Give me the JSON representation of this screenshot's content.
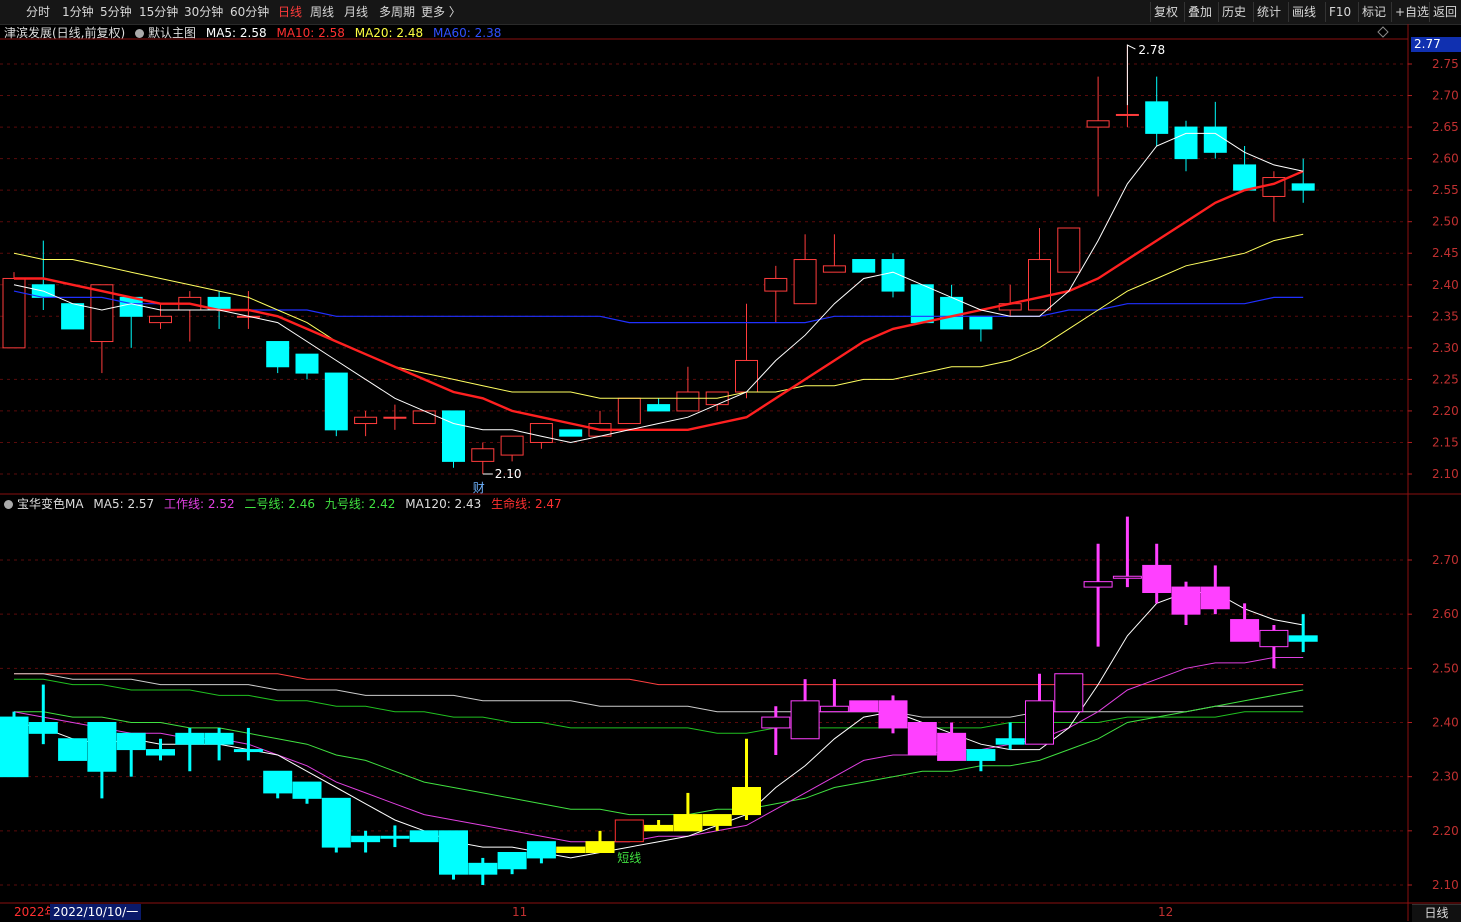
{
  "toolbar": {
    "periods": [
      "分时",
      "1分钟",
      "5分钟",
      "15分钟",
      "30分钟",
      "60分钟",
      "日线",
      "周线",
      "月线",
      "多周期",
      "更多 〉"
    ],
    "active_period": "日线",
    "right_buttons": [
      "复权",
      "叠加",
      "历史",
      "统计",
      "画线",
      "F10",
      "标记",
      "+自选",
      "返回"
    ]
  },
  "main_legend": {
    "stock": "津滨发展(日线,前复权)",
    "template": "默认主图",
    "ma5": "MA5: 2.58",
    "ma10": "MA10: 2.58",
    "ma20": "MA20: 2.48",
    "ma60": "MA60: 2.38"
  },
  "sub_legend": {
    "indicator": "宝华变色MA",
    "ma5": "MA5: 2.57",
    "work": "工作线: 2.52",
    "line2": "二号线: 2.46",
    "line9": "九号线: 2.42",
    "ma120": "MA120: 2.43",
    "life": "生命线: 2.47"
  },
  "annotations": {
    "high_label": "2.78",
    "low_label": "2.10",
    "cai_label": "财",
    "short_label": "短线",
    "current_price": "2.77"
  },
  "axis": {
    "main_ticks": [
      "2.75",
      "2.70",
      "2.65",
      "2.60",
      "2.55",
      "2.50",
      "2.45",
      "2.40",
      "2.35",
      "2.30",
      "2.25",
      "2.20",
      "2.15",
      "2.10"
    ],
    "sub_ticks": [
      "2.70",
      "2.60",
      "2.50",
      "2.40",
      "2.30",
      "2.20",
      "2.10"
    ],
    "year_label": "2022年",
    "date_label": "2022/10/10/一",
    "month_ticks": [
      "11",
      "12"
    ],
    "period_label": "日线"
  },
  "colors": {
    "up": "#ff3c3c",
    "down": "#00ffff",
    "ma5": "#ffffff",
    "ma10": "#ff2020",
    "ma20": "#ffff60",
    "ma60": "#2030ff",
    "work": "#e040e0",
    "line2": "#40e040",
    "life": "#ff4040",
    "grid": "#801010"
  },
  "chart_data": {
    "type": "candlestick",
    "candles": [
      {
        "o": 2.3,
        "c": 2.41,
        "h": 2.42,
        "l": 2.3
      },
      {
        "o": 2.4,
        "c": 2.38,
        "h": 2.47,
        "l": 2.36
      },
      {
        "o": 2.37,
        "c": 2.33,
        "h": 2.37,
        "l": 2.33
      },
      {
        "o": 2.31,
        "c": 2.4,
        "h": 2.4,
        "l": 2.26
      },
      {
        "o": 2.38,
        "c": 2.35,
        "h": 2.38,
        "l": 2.3
      },
      {
        "o": 2.34,
        "c": 2.35,
        "h": 2.37,
        "l": 2.33
      },
      {
        "o": 2.36,
        "c": 2.38,
        "h": 2.39,
        "l": 2.31
      },
      {
        "o": 2.38,
        "c": 2.36,
        "h": 2.39,
        "l": 2.33
      },
      {
        "o": 2.35,
        "c": 2.35,
        "h": 2.39,
        "l": 2.33
      },
      {
        "o": 2.31,
        "c": 2.27,
        "h": 2.31,
        "l": 2.26
      },
      {
        "o": 2.29,
        "c": 2.26,
        "h": 2.29,
        "l": 2.25
      },
      {
        "o": 2.26,
        "c": 2.17,
        "h": 2.26,
        "l": 2.16
      },
      {
        "o": 2.18,
        "c": 2.19,
        "h": 2.2,
        "l": 2.16
      },
      {
        "o": 2.19,
        "c": 2.19,
        "h": 2.21,
        "l": 2.17
      },
      {
        "o": 2.18,
        "c": 2.2,
        "h": 2.2,
        "l": 2.18
      },
      {
        "o": 2.2,
        "c": 2.12,
        "h": 2.2,
        "l": 2.11
      },
      {
        "o": 2.12,
        "c": 2.14,
        "h": 2.15,
        "l": 2.1
      },
      {
        "o": 2.13,
        "c": 2.16,
        "h": 2.16,
        "l": 2.12
      },
      {
        "o": 2.15,
        "c": 2.18,
        "h": 2.18,
        "l": 2.14
      },
      {
        "o": 2.17,
        "c": 2.16,
        "h": 2.17,
        "l": 2.16
      },
      {
        "o": 2.16,
        "c": 2.18,
        "h": 2.2,
        "l": 2.16
      },
      {
        "o": 2.18,
        "c": 2.22,
        "h": 2.22,
        "l": 2.18
      },
      {
        "o": 2.21,
        "c": 2.2,
        "h": 2.22,
        "l": 2.2
      },
      {
        "o": 2.2,
        "c": 2.23,
        "h": 2.27,
        "l": 2.2
      },
      {
        "o": 2.21,
        "c": 2.23,
        "h": 2.23,
        "l": 2.2
      },
      {
        "o": 2.23,
        "c": 2.28,
        "h": 2.37,
        "l": 2.22
      },
      {
        "o": 2.39,
        "c": 2.41,
        "h": 2.43,
        "l": 2.34
      },
      {
        "o": 2.37,
        "c": 2.44,
        "h": 2.48,
        "l": 2.37
      },
      {
        "o": 2.42,
        "c": 2.43,
        "h": 2.48,
        "l": 2.42
      },
      {
        "o": 2.44,
        "c": 2.42,
        "h": 2.44,
        "l": 2.42
      },
      {
        "o": 2.44,
        "c": 2.39,
        "h": 2.45,
        "l": 2.38
      },
      {
        "o": 2.4,
        "c": 2.34,
        "h": 2.4,
        "l": 2.34
      },
      {
        "o": 2.38,
        "c": 2.33,
        "h": 2.4,
        "l": 2.33
      },
      {
        "o": 2.35,
        "c": 2.33,
        "h": 2.35,
        "l": 2.31
      },
      {
        "o": 2.36,
        "c": 2.37,
        "h": 2.4,
        "l": 2.35
      },
      {
        "o": 2.36,
        "c": 2.44,
        "h": 2.49,
        "l": 2.36
      },
      {
        "o": 2.42,
        "c": 2.49,
        "h": 2.49,
        "l": 2.42
      },
      {
        "o": 2.65,
        "c": 2.66,
        "h": 2.73,
        "l": 2.54
      },
      {
        "o": 2.67,
        "c": 2.67,
        "h": 2.78,
        "l": 2.65
      },
      {
        "o": 2.69,
        "c": 2.64,
        "h": 2.73,
        "l": 2.62
      },
      {
        "o": 2.65,
        "c": 2.6,
        "h": 2.66,
        "l": 2.58
      },
      {
        "o": 2.65,
        "c": 2.61,
        "h": 2.69,
        "l": 2.6
      },
      {
        "o": 2.59,
        "c": 2.55,
        "h": 2.62,
        "l": 2.55
      },
      {
        "o": 2.54,
        "c": 2.57,
        "h": 2.58,
        "l": 2.5
      },
      {
        "o": 2.56,
        "c": 2.55,
        "h": 2.6,
        "l": 2.53
      }
    ],
    "ma5": [
      2.4,
      2.39,
      2.37,
      2.36,
      2.37,
      2.36,
      2.36,
      2.36,
      2.35,
      2.34,
      2.31,
      2.28,
      2.25,
      2.22,
      2.2,
      2.18,
      2.17,
      2.17,
      2.16,
      2.15,
      2.16,
      2.17,
      2.18,
      2.19,
      2.21,
      2.23,
      2.28,
      2.32,
      2.37,
      2.41,
      2.42,
      2.4,
      2.38,
      2.36,
      2.35,
      2.35,
      2.39,
      2.47,
      2.56,
      2.62,
      2.64,
      2.64,
      2.61,
      2.59,
      2.58
    ],
    "ma10": [
      2.41,
      2.41,
      2.4,
      2.39,
      2.38,
      2.37,
      2.37,
      2.36,
      2.36,
      2.35,
      2.33,
      2.31,
      2.29,
      2.27,
      2.25,
      2.23,
      2.22,
      2.2,
      2.19,
      2.18,
      2.17,
      2.17,
      2.17,
      2.17,
      2.18,
      2.19,
      2.22,
      2.25,
      2.28,
      2.31,
      2.33,
      2.34,
      2.35,
      2.36,
      2.37,
      2.38,
      2.39,
      2.41,
      2.44,
      2.47,
      2.5,
      2.53,
      2.55,
      2.56,
      2.58
    ],
    "ma20": [
      2.45,
      2.44,
      2.44,
      2.43,
      2.42,
      2.41,
      2.4,
      2.39,
      2.38,
      2.36,
      2.34,
      2.31,
      2.29,
      2.27,
      2.26,
      2.25,
      2.24,
      2.23,
      2.23,
      2.23,
      2.22,
      2.22,
      2.22,
      2.22,
      2.22,
      2.23,
      2.23,
      2.24,
      2.24,
      2.25,
      2.25,
      2.26,
      2.27,
      2.27,
      2.28,
      2.3,
      2.33,
      2.36,
      2.39,
      2.41,
      2.43,
      2.44,
      2.45,
      2.47,
      2.48
    ],
    "ma60": [
      2.39,
      2.38,
      2.38,
      2.38,
      2.37,
      2.37,
      2.37,
      2.36,
      2.36,
      2.36,
      2.36,
      2.35,
      2.35,
      2.35,
      2.35,
      2.35,
      2.35,
      2.35,
      2.35,
      2.35,
      2.35,
      2.34,
      2.34,
      2.34,
      2.34,
      2.34,
      2.34,
      2.34,
      2.35,
      2.35,
      2.35,
      2.35,
      2.35,
      2.35,
      2.35,
      2.35,
      2.36,
      2.36,
      2.37,
      2.37,
      2.37,
      2.37,
      2.37,
      2.38,
      2.38
    ],
    "sub_work": [
      2.42,
      2.41,
      2.4,
      2.39,
      2.38,
      2.38,
      2.37,
      2.37,
      2.36,
      2.34,
      2.32,
      2.29,
      2.27,
      2.25,
      2.23,
      2.22,
      2.21,
      2.2,
      2.19,
      2.18,
      2.18,
      2.18,
      2.19,
      2.19,
      2.2,
      2.21,
      2.24,
      2.27,
      2.3,
      2.33,
      2.34,
      2.34,
      2.35,
      2.35,
      2.36,
      2.37,
      2.39,
      2.42,
      2.46,
      2.48,
      2.5,
      2.51,
      2.51,
      2.52,
      2.52
    ],
    "sub_line2": [
      2.42,
      2.42,
      2.41,
      2.41,
      2.4,
      2.4,
      2.39,
      2.39,
      2.38,
      2.37,
      2.36,
      2.34,
      2.33,
      2.31,
      2.29,
      2.28,
      2.27,
      2.26,
      2.25,
      2.24,
      2.24,
      2.23,
      2.23,
      2.23,
      2.24,
      2.24,
      2.25,
      2.26,
      2.28,
      2.29,
      2.3,
      2.31,
      2.31,
      2.32,
      2.32,
      2.33,
      2.35,
      2.37,
      2.4,
      2.41,
      2.42,
      2.43,
      2.44,
      2.45,
      2.46
    ],
    "sub_line9": [
      2.48,
      2.48,
      2.47,
      2.47,
      2.46,
      2.46,
      2.46,
      2.45,
      2.45,
      2.44,
      2.44,
      2.43,
      2.43,
      2.42,
      2.42,
      2.41,
      2.41,
      2.4,
      2.4,
      2.39,
      2.39,
      2.39,
      2.39,
      2.39,
      2.38,
      2.38,
      2.39,
      2.39,
      2.39,
      2.39,
      2.39,
      2.39,
      2.39,
      2.39,
      2.4,
      2.4,
      2.4,
      2.4,
      2.41,
      2.41,
      2.41,
      2.41,
      2.42,
      2.42,
      2.42
    ],
    "sub_ma120": [
      2.49,
      2.49,
      2.48,
      2.48,
      2.48,
      2.47,
      2.47,
      2.47,
      2.47,
      2.46,
      2.46,
      2.46,
      2.45,
      2.45,
      2.45,
      2.45,
      2.44,
      2.44,
      2.44,
      2.44,
      2.43,
      2.43,
      2.43,
      2.43,
      2.42,
      2.42,
      2.42,
      2.42,
      2.42,
      2.42,
      2.42,
      2.41,
      2.41,
      2.41,
      2.41,
      2.42,
      2.42,
      2.42,
      2.42,
      2.42,
      2.42,
      2.43,
      2.43,
      2.43,
      2.43
    ],
    "sub_life": [
      2.49,
      2.49,
      2.49,
      2.49,
      2.49,
      2.49,
      2.49,
      2.49,
      2.49,
      2.49,
      2.48,
      2.48,
      2.48,
      2.48,
      2.48,
      2.48,
      2.48,
      2.48,
      2.48,
      2.48,
      2.48,
      2.48,
      2.47,
      2.47,
      2.47,
      2.47,
      2.47,
      2.47,
      2.47,
      2.47,
      2.47,
      2.47,
      2.47,
      2.47,
      2.47,
      2.47,
      2.47,
      2.47,
      2.47,
      2.47,
      2.47,
      2.47,
      2.47,
      2.47,
      2.47
    ],
    "sub_colors": [
      "cyan",
      "cyan",
      "cyan",
      "cyan",
      "cyan",
      "cyan",
      "cyan",
      "cyan",
      "cyan",
      "cyan",
      "cyan",
      "cyan",
      "cyan",
      "cyan",
      "cyan",
      "cyan",
      "cyan",
      "cyan",
      "cyan",
      "yellow",
      "yellow",
      "red",
      "yellow",
      "yellow",
      "yellow",
      "yellow",
      "magenta",
      "magenta",
      "magenta",
      "magenta",
      "magenta",
      "magenta",
      "magenta",
      "cyan",
      "cyan",
      "magenta",
      "magenta",
      "magenta",
      "magenta",
      "magenta",
      "magenta",
      "magenta",
      "magenta",
      "magenta",
      "cyan"
    ]
  }
}
